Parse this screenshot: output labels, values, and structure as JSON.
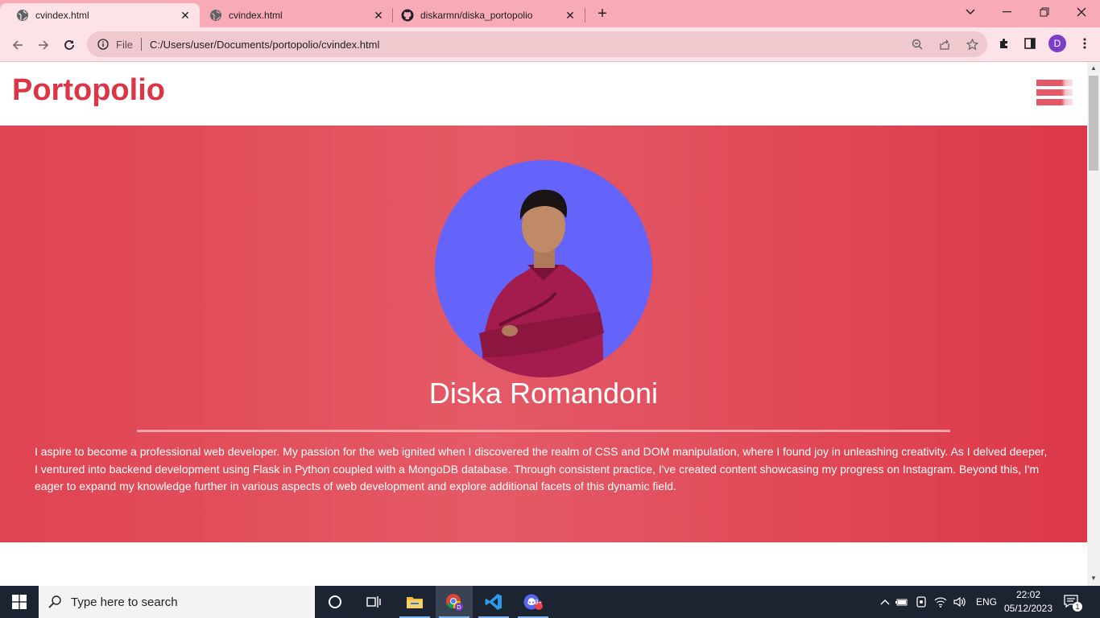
{
  "browser": {
    "tabs": [
      {
        "title": "cvindex.html",
        "favicon": "globe-icon",
        "active": true
      },
      {
        "title": "cvindex.html",
        "favicon": "globe-icon",
        "active": false
      },
      {
        "title": "diskarmn/diska_portopolio",
        "favicon": "github-icon",
        "active": false
      }
    ],
    "address": {
      "scheme_label": "File",
      "url": "C:/Users/user/Documents/portopolio/cvindex.html"
    },
    "profile_initial": "D",
    "colors": {
      "tabbar": "#f9aab7",
      "toolbar": "#fde3e7",
      "omnibox": "#f0c9cf"
    }
  },
  "page": {
    "brand": "Portopolio",
    "hero": {
      "name": "Diska Romandoni",
      "bio": "I aspire to become a professional web developer. My passion for the web ignited when I discovered the realm of CSS and DOM manipulation, where I found joy in unleashing creativity. As I delved deeper, I ventured into backend development using Flask in Python coupled with a MongoDB database. Through consistent practice, I've created content showcasing my progress on Instagram. Beyond this, I'm eager to expand my knowledge further in various aspects of web development and explore additional facets of this dynamic field."
    },
    "colors": {
      "accent": "#dc3545",
      "avatar_bg": "#6464fb"
    }
  },
  "taskbar": {
    "search_placeholder": "Type here to search",
    "language": "ENG",
    "time": "22:02",
    "date": "05/12/2023",
    "notification_count": "1",
    "badge": "9+"
  }
}
